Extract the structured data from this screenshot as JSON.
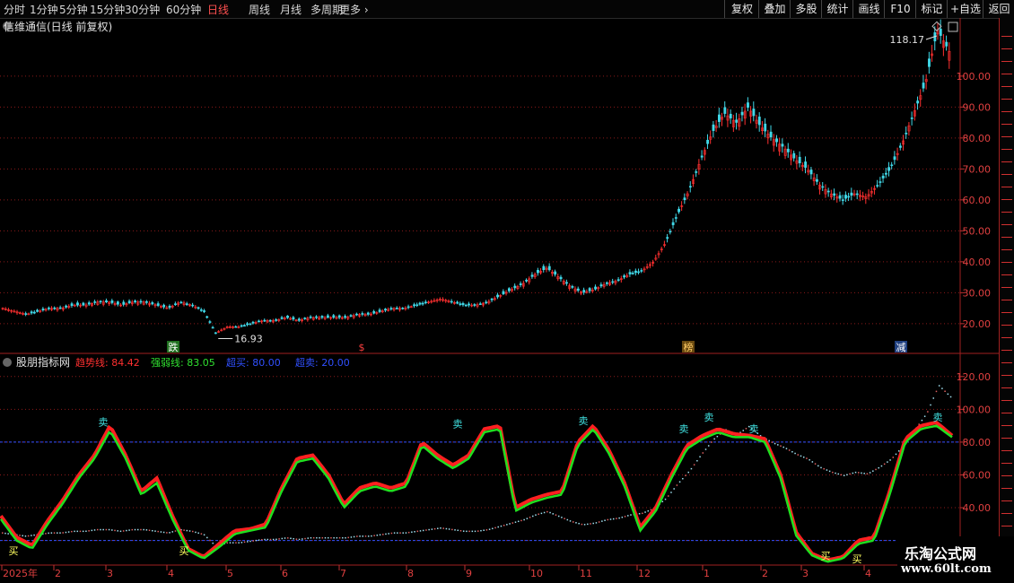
{
  "toolbar": {
    "periods": [
      "分时",
      "1分钟",
      "5分钟",
      "15分钟",
      "30分钟",
      "60分钟",
      "日线",
      "周线",
      "月线",
      "多周期",
      "更多"
    ],
    "active": "日线",
    "right": [
      "复权",
      "叠加",
      "多股",
      "统计",
      "画线",
      "F10",
      "标记",
      "+自选",
      "返回"
    ]
  },
  "main_panel": {
    "title": "信维通信(日线 前复权)",
    "max_label": "118.17",
    "min_label": "16.93",
    "markers": [
      "跌",
      "$",
      "榜",
      "减"
    ]
  },
  "indicator_panel": {
    "name": "股朋指标网",
    "legend": [
      {
        "label": "趋势线:",
        "value": "84.42",
        "color": "#ff3030"
      },
      {
        "label": "强弱线:",
        "value": "83.05",
        "color": "#30e030"
      },
      {
        "label": "超买:",
        "value": "80.00",
        "color": "#3050ff"
      },
      {
        "label": "超卖:",
        "value": "20.00",
        "color": "#3050ff"
      }
    ],
    "signal_buy": "买",
    "signal_sell": "卖"
  },
  "colors": {
    "up": "#ff3030",
    "down": "#40d8e8",
    "grid": "#8b1a1a",
    "trend": "#ff2020",
    "strength": "#20e020",
    "bound": "#3050ff"
  },
  "watermark": {
    "line1": "乐淘公式网",
    "line2": "www.60lt.com"
  },
  "chart_data": [
    {
      "type": "line",
      "title": "信维通信(日线 前复权)",
      "y_ticks": [
        20,
        30,
        40,
        50,
        60,
        70,
        80,
        90,
        100
      ],
      "ylim": [
        13,
        113
      ],
      "x_labels": [
        "2025年",
        "2",
        "3",
        "4",
        "5",
        "6",
        "7",
        "8",
        "9",
        "10",
        "11",
        "12",
        "1",
        "2",
        "3",
        "4"
      ],
      "series": [
        {
          "name": "收盘",
          "values": [
            25,
            24,
            23,
            24,
            25,
            25,
            26,
            26,
            27,
            27,
            26,
            27,
            27,
            26,
            25,
            27,
            26,
            24,
            17,
            19,
            19,
            20,
            21,
            21,
            22,
            21,
            22,
            22,
            22,
            22,
            23,
            23,
            24,
            25,
            25,
            26,
            27,
            28,
            27,
            26,
            26,
            27,
            29,
            31,
            33,
            36,
            38,
            35,
            32,
            30,
            31,
            33,
            34,
            36,
            37,
            40,
            46,
            55,
            63,
            73,
            82,
            88,
            85,
            90,
            84,
            80,
            77,
            73,
            70,
            65,
            62,
            60,
            62,
            61,
            65,
            70,
            78,
            88,
            98,
            115,
            108
          ]
        }
      ],
      "max_value": 118.17,
      "min_value": 16.93
    },
    {
      "type": "line",
      "title": "股朋指标网",
      "y_ticks": [
        20,
        40,
        60,
        80,
        100,
        120
      ],
      "ylim": [
        5,
        127
      ],
      "series": [
        {
          "name": "趋势线",
          "values": [
            35,
            22,
            17,
            32,
            45,
            60,
            72,
            90,
            72,
            50,
            58,
            35,
            15,
            10,
            18,
            26,
            27,
            30,
            52,
            70,
            72,
            60,
            42,
            52,
            55,
            52,
            55,
            80,
            72,
            66,
            72,
            88,
            90,
            40,
            45,
            48,
            50,
            80,
            90,
            75,
            55,
            28,
            40,
            60,
            78,
            84,
            88,
            85,
            84,
            82,
            60,
            25,
            12,
            8,
            10,
            20,
            22,
            50,
            82,
            90,
            92,
            84
          ]
        },
        {
          "name": "强弱线",
          "values": [
            33,
            20,
            15,
            30,
            43,
            58,
            70,
            87,
            70,
            48,
            55,
            33,
            14,
            9,
            16,
            24,
            26,
            28,
            50,
            68,
            70,
            58,
            40,
            50,
            53,
            50,
            53,
            78,
            70,
            64,
            70,
            86,
            88,
            38,
            43,
            46,
            48,
            78,
            88,
            73,
            53,
            26,
            38,
            58,
            76,
            82,
            86,
            83,
            83,
            80,
            58,
            23,
            11,
            7,
            9,
            18,
            20,
            48,
            80,
            88,
            90,
            83
          ]
        },
        {
          "name": "超买",
          "values": [
            80
          ]
        },
        {
          "name": "超卖",
          "values": [
            20
          ]
        }
      ]
    }
  ]
}
